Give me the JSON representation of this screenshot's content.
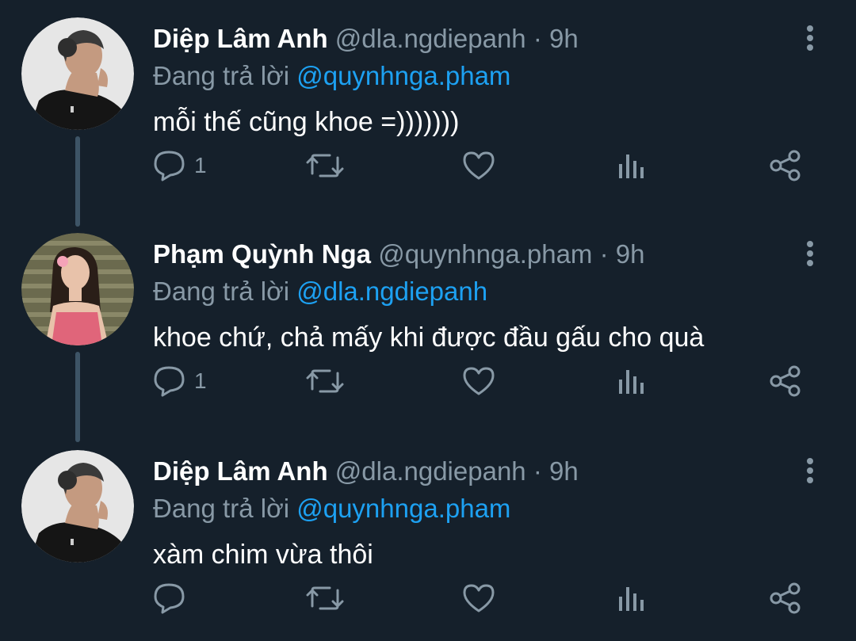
{
  "tweets": [
    {
      "display_name": "Diệp Lâm Anh",
      "handle": "@dla.ngdiepanh",
      "separator": "·",
      "time": "9h",
      "reply_prefix": "Đang trả lời",
      "reply_to": "@quynhnga.pham",
      "text": "mỗi thế cũng khoe =)))))))",
      "reply_count": "1",
      "avatar_icon": "avatar-man-photo"
    },
    {
      "display_name": "Phạm Quỳnh Nga",
      "handle": "@quynhnga.pham",
      "separator": "·",
      "time": "9h",
      "reply_prefix": "Đang trả lời",
      "reply_to": "@dla.ngdiepanh",
      "text": "khoe chứ, chả mấy khi được đầu gấu cho quà",
      "reply_count": "1",
      "avatar_icon": "avatar-woman-photo"
    },
    {
      "display_name": "Diệp Lâm Anh",
      "handle": "@dla.ngdiepanh",
      "separator": "·",
      "time": "9h",
      "reply_prefix": "Đang trả lời",
      "reply_to": "@quynhnga.pham",
      "text": "xàm chim vừa thôi",
      "reply_count": "",
      "avatar_icon": "avatar-man-photo"
    }
  ],
  "colors": {
    "background": "#15202b",
    "name": "#ffffff",
    "secondary": "#8899a6",
    "link": "#1da1f2",
    "thread_line": "#3d5466"
  }
}
